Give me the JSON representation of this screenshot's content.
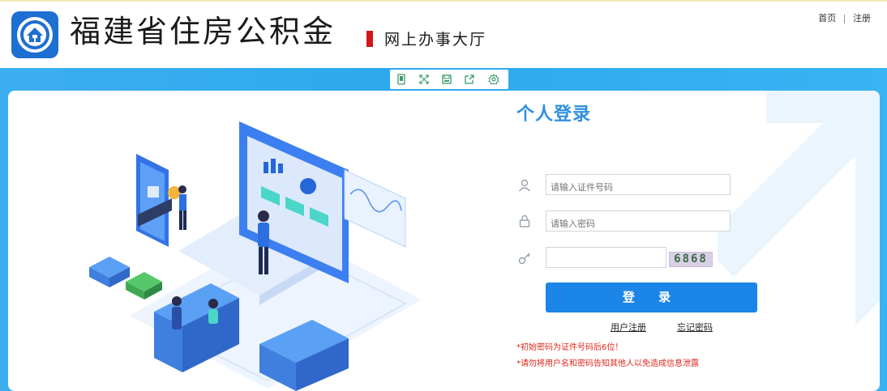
{
  "header": {
    "title": "福建省住房公积金",
    "subtitle": "网上办事大厅",
    "links": [
      "首页",
      "注册"
    ]
  },
  "toolbar": {
    "icons": [
      "mobile-icon",
      "fullscreen-icon",
      "save-icon",
      "share-icon",
      "settings-icon"
    ]
  },
  "login": {
    "title": "个人登录",
    "id_placeholder": "请输入证件号码",
    "password_placeholder": "请输入密码",
    "captcha_value": "",
    "captcha_text": "6868",
    "submit_label": "登 录",
    "register_link": "用户注册",
    "forgot_link": "忘记密码",
    "notes": [
      "*初始密码为证件号码后6位！",
      "*请勿将用户名和密码告知其他人以免造成信息泄露"
    ]
  },
  "colors": {
    "brand_blue": "#1b85e8",
    "banner_blue": "#2ea8ee",
    "title_blue": "#2f8ee0",
    "warning_red": "#e0261c",
    "accent_red": "#d01818"
  }
}
